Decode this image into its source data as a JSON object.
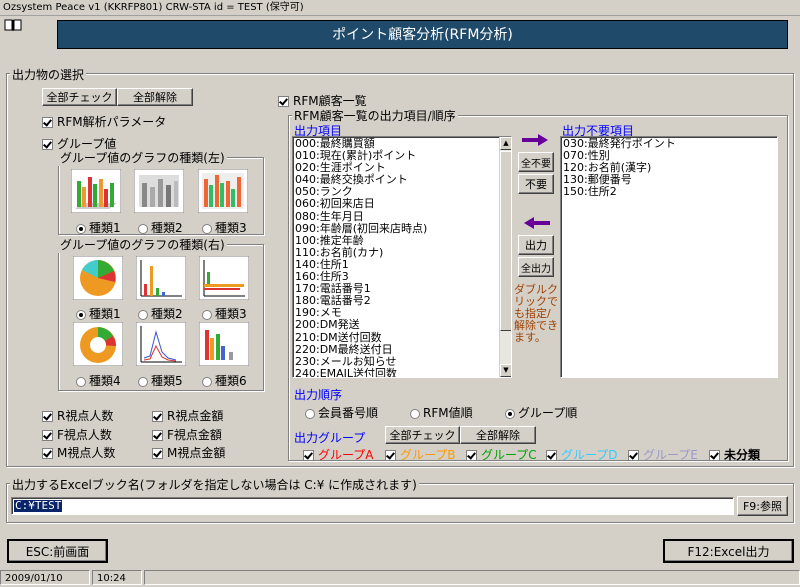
{
  "window": {
    "title": "Ozsystem Peace v1 (KKRFP801)   CRW-STA   id = TEST   (保守可)"
  },
  "banner": {
    "title": "ポイント顧客分析(RFM分析)"
  },
  "output_selection": {
    "legend": "出力物の選択",
    "check_all": "全部チェック",
    "uncheck_all": "全部解除",
    "rfm_params": {
      "label": "RFM解析パラメータ",
      "checked": true
    },
    "group_value": {
      "label": "グループ値",
      "checked": true
    },
    "graph_left": {
      "legend": "グループ値のグラフの種類(左)",
      "options": [
        "種類1",
        "種類2",
        "種類3"
      ],
      "selected": "種類1"
    },
    "graph_right": {
      "legend": "グループ値のグラフの種類(右)",
      "options": [
        "種類1",
        "種類2",
        "種類3",
        "種類4",
        "種類5",
        "種類6"
      ],
      "selected": "種類1"
    },
    "metrics": [
      {
        "label": "R視点人数",
        "checked": true
      },
      {
        "label": "R視点金額",
        "checked": true
      },
      {
        "label": "F視点人数",
        "checked": true
      },
      {
        "label": "F視点金額",
        "checked": true
      },
      {
        "label": "M視点人数",
        "checked": true
      },
      {
        "label": "M視点金額",
        "checked": true
      }
    ]
  },
  "rfm_list": {
    "label": "RFM顧客一覧",
    "checked": true,
    "legend": "RFM顧客一覧の出力項目/順序",
    "output_items_title": "出力項目",
    "output_items": [
      "000:最終購買額",
      "010:現在(累計)ポイント",
      "020:生涯ポイント",
      "040:最終交換ポイント",
      "050:ランク",
      "060:初回来店日",
      "080:生年月日",
      "090:年齢層(初回来店時点)",
      "100:推定年齢",
      "110:お名前(カナ)",
      "140:住所1",
      "160:住所3",
      "170:電話番号1",
      "180:電話番号2",
      "190:メモ",
      "200:DM発送",
      "210:DM送付回数",
      "220:DM最終送付日",
      "230:メールお知らせ",
      "240:EMAIL送付回数"
    ],
    "unneeded_title": "出力不要項目",
    "unneeded_items": [
      "030:最終発行ポイント",
      "070:性別",
      "120:お名前(漢字)",
      "130:郵便番号",
      "150:住所2"
    ],
    "btn_all_unneeded": "全不要",
    "btn_unneeded": "不要",
    "btn_output": "出力",
    "btn_all_output": "全出力",
    "hint": "ダブルクリックでも指定/解除できます。",
    "order_title": "出力順序",
    "order_options": [
      "会員番号順",
      "RFM値順",
      "グループ順"
    ],
    "order_selected": "グループ順",
    "group_title": "出力グループ",
    "group_check_all": "全部チェック",
    "group_uncheck_all": "全部解除",
    "groups": [
      {
        "label": "グループA",
        "color": "#ff0000",
        "checked": true
      },
      {
        "label": "グループB",
        "color": "#ff9900",
        "checked": true
      },
      {
        "label": "グループC",
        "color": "#00a000",
        "checked": true
      },
      {
        "label": "グループD",
        "color": "#33ccff",
        "checked": true
      },
      {
        "label": "グループE",
        "color": "#9999cc",
        "checked": true
      },
      {
        "label": "未分類",
        "color": "#000000",
        "checked": true
      }
    ]
  },
  "excel": {
    "legend": "出力するExcelブック名(フォルダを指定しない場合は C:¥ に作成されます)",
    "value": "C:¥TEST",
    "browse": "F9:参照"
  },
  "footer": {
    "back": "ESC:前画面",
    "excel_output": "F12:Excel出力"
  },
  "status": {
    "date": "2009/01/10",
    "time": "10:24"
  }
}
